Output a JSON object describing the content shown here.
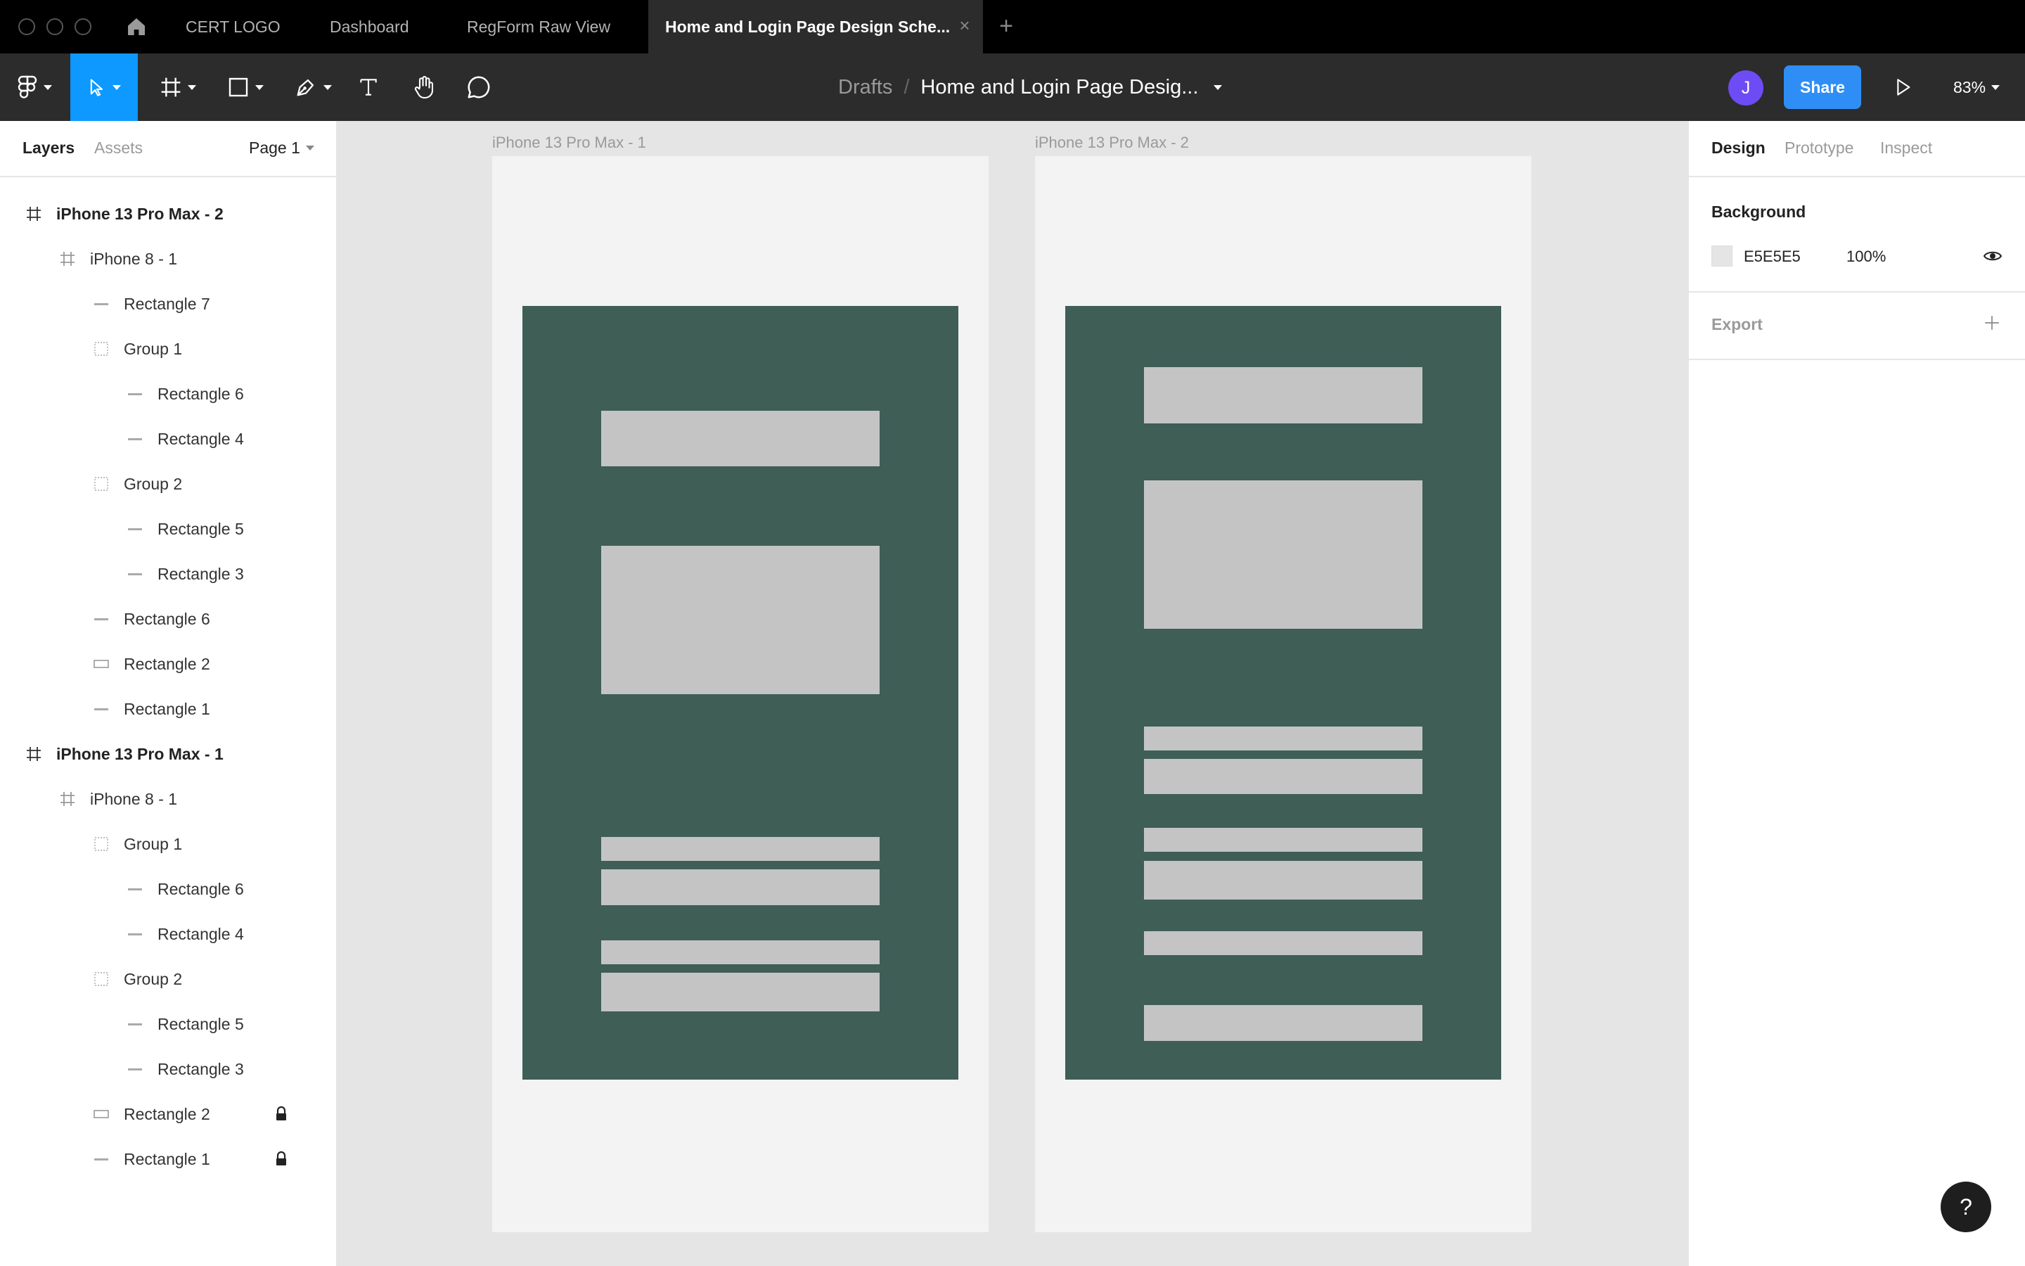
{
  "titlebar": {
    "tabs": [
      {
        "label": "CERT LOGO"
      },
      {
        "label": "Dashboard"
      },
      {
        "label": "RegForm Raw View"
      },
      {
        "label": "Home and Login Page Design Sche..."
      }
    ],
    "close_glyph": "×",
    "add_glyph": "+"
  },
  "toolbar": {
    "breadcrumb_root": "Drafts",
    "breadcrumb_sep": "/",
    "file_name": "Home and Login Page Desig...",
    "avatar_initial": "J",
    "share_label": "Share",
    "zoom": "83%",
    "tools": [
      "figma-menu",
      "move",
      "frame",
      "shape",
      "pen",
      "text",
      "hand",
      "comment"
    ]
  },
  "left_panel": {
    "tabs": [
      {
        "label": "Layers"
      },
      {
        "label": "Assets"
      }
    ],
    "page": "Page 1",
    "layers": [
      {
        "name": "iPhone 13 Pro Max - 2",
        "icon": "frame-icon",
        "top": true
      },
      {
        "name": "iPhone 8 - 1",
        "icon": "frame-icon"
      },
      {
        "name": "Rectangle 7",
        "icon": "rect-icon"
      },
      {
        "name": "Group 1",
        "icon": "group-icon"
      },
      {
        "name": "Rectangle 6",
        "icon": "rect-icon"
      },
      {
        "name": "Rectangle 4",
        "icon": "rect-icon"
      },
      {
        "name": "Group 2",
        "icon": "group-icon"
      },
      {
        "name": "Rectangle 5",
        "icon": "rect-icon"
      },
      {
        "name": "Rectangle 3",
        "icon": "rect-icon"
      },
      {
        "name": "Rectangle 6",
        "icon": "rect-icon"
      },
      {
        "name": "Rectangle 2",
        "icon": "rect-outline-icon"
      },
      {
        "name": "Rectangle 1",
        "icon": "rect-icon"
      },
      {
        "name": "iPhone 13 Pro Max - 1",
        "icon": "frame-icon",
        "top": true
      },
      {
        "name": "iPhone 8 - 1",
        "icon": "frame-icon"
      },
      {
        "name": "Group 1",
        "icon": "group-icon"
      },
      {
        "name": "Rectangle 6",
        "icon": "rect-icon"
      },
      {
        "name": "Rectangle 4",
        "icon": "rect-icon"
      },
      {
        "name": "Group 2",
        "icon": "group-icon"
      },
      {
        "name": "Rectangle 5",
        "icon": "rect-icon"
      },
      {
        "name": "Rectangle 3",
        "icon": "rect-icon"
      },
      {
        "name": "Rectangle 2",
        "icon": "rect-outline-icon",
        "locked": true
      },
      {
        "name": "Rectangle 1",
        "icon": "rect-icon",
        "locked": true
      }
    ]
  },
  "canvas": {
    "frames": [
      {
        "label": "iPhone 13 Pro Max - 1"
      },
      {
        "label": "iPhone 13 Pro Max - 2"
      }
    ],
    "colors": {
      "canvas_bg": "#e5e5e5",
      "frame_bg": "#f3f3f3",
      "inner_bg": "#3e5e56",
      "placeholder": "#c4c4c4"
    }
  },
  "right_panel": {
    "tabs": [
      {
        "label": "Design"
      },
      {
        "label": "Prototype"
      },
      {
        "label": "Inspect"
      }
    ],
    "background_title": "Background",
    "background_hex": "E5E5E5",
    "background_opacity": "100%",
    "export_title": "Export"
  },
  "help_label": "?"
}
